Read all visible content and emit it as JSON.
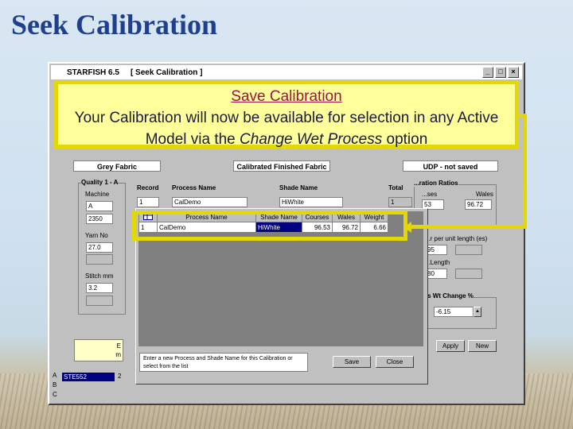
{
  "slide": {
    "title": "Seek Calibration"
  },
  "window": {
    "app_name": "STARFISH 6.5",
    "caption": "[ Seek Calibration ]",
    "minimize": "_",
    "maximize": "□",
    "close": "×"
  },
  "callout": {
    "title": "Save Calibration",
    "line1": "Your Calibration will now be available for selection in any Active",
    "line2_pre": "Model via the ",
    "line2_em": "Change Wet Process",
    "line2_post": " option"
  },
  "headers": {
    "grey_fabric": "Grey Fabric",
    "calibrated_finished": "Calibrated Finished Fabric",
    "udp": "UDP - not saved"
  },
  "quality": {
    "label": "Quality 1 - A",
    "machine_label": "Machine",
    "machine_value": "A",
    "machine_extra": "2350",
    "yarn_label": "Yarn No",
    "yarn_value": "27.0",
    "stitch_label": "Stitch mm",
    "stitch_value": "3.2"
  },
  "record_row": {
    "record_label": "Record",
    "record_value": "1",
    "process_label": "Process Name",
    "process_value": "CalDemo",
    "shade_label": "Shade Name",
    "shade_value": "HiWhite",
    "total_label": "Total",
    "total_value": "1"
  },
  "ratios": {
    "label": "...ration Ratios",
    "courses_label": "...ses",
    "wales_label": "Wales",
    "courses_value": "53",
    "wales_value": "96.72",
    "per_unit_label": "...r per unit length (es)",
    "v1": "95",
    "length_label": "...Length",
    "v2": "80",
    "wt_change_label": "...es Wt Change %",
    "wt_change_value": "-6.15"
  },
  "grid": {
    "columns": [
      "Process Name",
      "Shade Name",
      "Courses",
      "Wales",
      "Weight"
    ],
    "rows": [
      {
        "rec": "1",
        "process": "CalDemo",
        "shade": "HiWhite",
        "courses": "96.53",
        "wales": "96.72",
        "weight": "6.66"
      }
    ],
    "corner_icon": "table-icon"
  },
  "hint": {
    "text": "Enter a new Process and Shade Name for this Calibration or select from the list"
  },
  "dialog_buttons": {
    "save": "Save",
    "close": "Close"
  },
  "main_buttons": {
    "apply": "Apply",
    "new": "New"
  },
  "status": {
    "row_a": "A",
    "row_b": "B",
    "row_c": "C",
    "selected": "STE552",
    "row_a_col2": "2"
  },
  "left_yellow": {
    "text1": "E",
    "text2": "m"
  }
}
